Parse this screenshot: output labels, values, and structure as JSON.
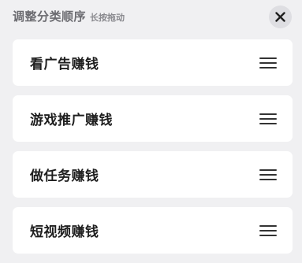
{
  "header": {
    "title": "调整分类顺序",
    "hint": "长按拖动"
  },
  "close_button": {
    "icon": "close-icon"
  },
  "categories": [
    {
      "label": "看广告赚钱",
      "icon": "drag-handle-icon"
    },
    {
      "label": "游戏推广赚钱",
      "icon": "drag-handle-icon"
    },
    {
      "label": "做任务赚钱",
      "icon": "drag-handle-icon"
    },
    {
      "label": "短视频赚钱",
      "icon": "drag-handle-icon"
    }
  ],
  "colors": {
    "background": "#f0f0f2",
    "card": "#ffffff",
    "title": "#6b6b70",
    "text": "#1f1f1f"
  }
}
